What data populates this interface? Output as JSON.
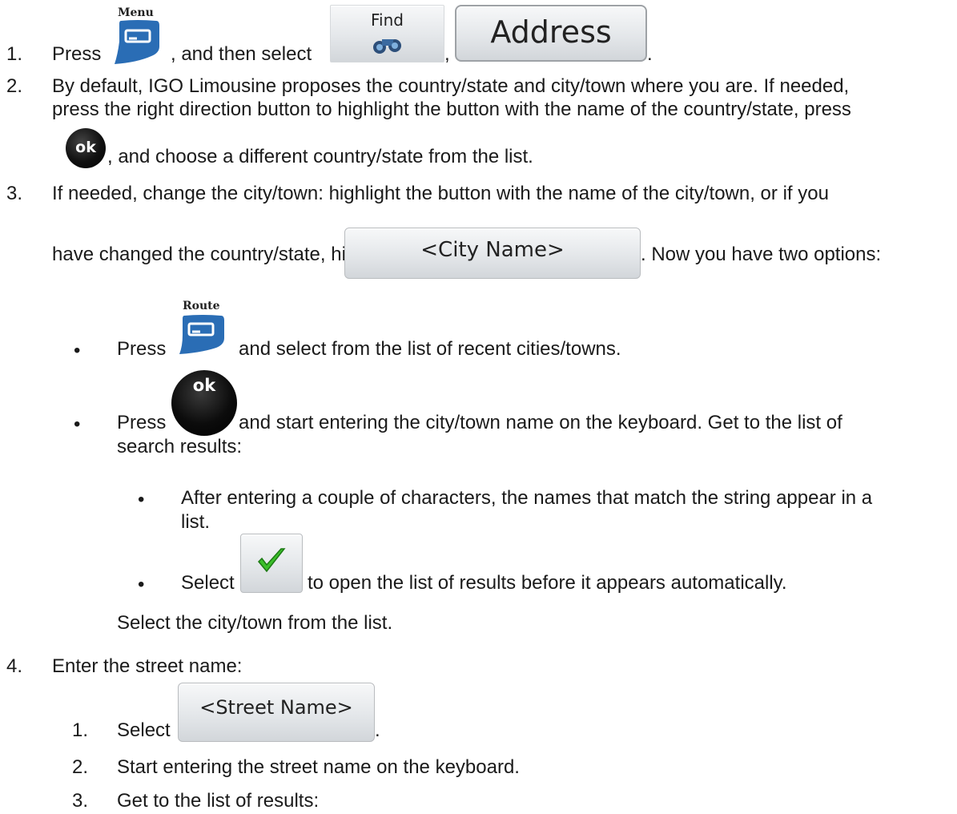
{
  "step1": {
    "num": "1.",
    "press": "Press",
    "menu_icon_label": "Menu",
    "and_then_select": ", and then select",
    "find_label": "Find",
    "comma": ",",
    "address_label": "Address",
    "period": "."
  },
  "step2": {
    "num": "2.",
    "line1": "By default, IGO Limousine proposes the country/state and city/town where you are. If needed,",
    "line2": "press the right direction button to highlight the button with the name of the country/state, press",
    "ok_label": "ok",
    "line3": ", and choose a different country/state from the list."
  },
  "step3": {
    "num": "3.",
    "line1": "If needed, change the city/town: highlight the button with the name of the city/town, or if you",
    "line2a": "have changed the country/state, highlight",
    "city_button": "<City Name>",
    "line2b": ". Now you have two options:",
    "bullet1": {
      "press": "Press",
      "route_label": "Route",
      "text": "and select from the list of recent cities/towns."
    },
    "bullet2": {
      "press": "Press",
      "ok_label": "ok",
      "text1": "and start entering the city/town name on the keyboard. Get to the list of",
      "text2": "search results:"
    },
    "sub1": {
      "text1": "After entering a couple of characters, the names that match the string appear in a",
      "text2": "list."
    },
    "sub2": {
      "select": "Select",
      "text": "to open the list of results before it appears automatically."
    },
    "after": "Select the city/town from the list."
  },
  "step4": {
    "num": "4.",
    "text": "Enter the street name:",
    "items": [
      {
        "num": "1.",
        "text": "Select",
        "button": "<Street Name>",
        "period": "."
      },
      {
        "num": "2.",
        "text": "Start entering the street name on the keyboard."
      },
      {
        "num": "3.",
        "text": "Get to the list of results:"
      }
    ]
  },
  "bullet_char": "•"
}
